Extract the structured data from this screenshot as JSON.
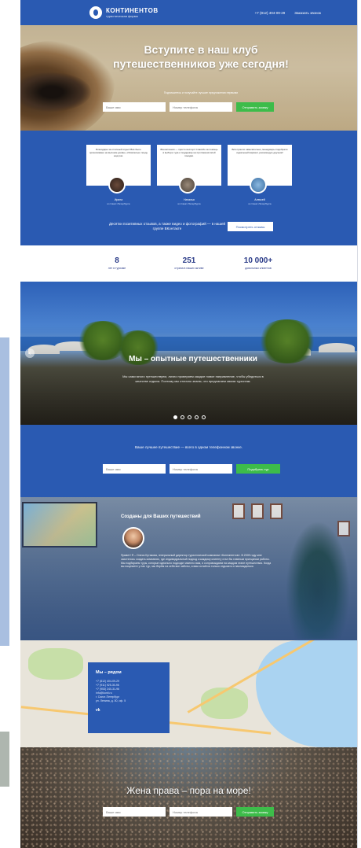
{
  "header": {
    "brand": "КОНТИНЕНТОВ",
    "brand_sub": "туристическая фирма",
    "phone": "+7 (812) 404-09-29",
    "callback": "Заказать звонок"
  },
  "hero": {
    "title": "Вступите в наш клуб путешественников уже сегодня!",
    "subtitle": "Подпишитесь и получайте лучшие предложения первыми",
    "name_placeholder": "Ваше имя",
    "phone_placeholder": "Номер телефона",
    "button": "Отправить заявку"
  },
  "testimonials": {
    "cards": [
      {
        "text": "Благодарю за отличный отдых! Всё было организовано на высшем уровне, обязательно поеду ещё раз.",
        "name": "Ирина",
        "role": "из Санкт-Петербурга"
      },
      {
        "text": "Впечатления — просто восторг! Спасибо за помощь в выборе тура и поддержку на протяжении всей поездки.",
        "name": "Наталья",
        "role": "из Санкт-Петербурга"
      },
      {
        "text": "Всё прошло замечательно, менеджеры подобрали идеальный вариант, рекомендую друзьям!",
        "name": "Алексей",
        "role": "из Санкт-Петербурга"
      }
    ],
    "footer_text": "Десятки позитивных отзывов, а также видео и фотографий — в нашей группе ВКонтакте",
    "footer_button": "Посмотреть отзывы"
  },
  "stats": [
    {
      "value": "8",
      "label": "лет в туризме"
    },
    {
      "value": "251",
      "label": "страна в наших активе"
    },
    {
      "value": "10 000+",
      "label": "довольных клиентов"
    }
  ],
  "slider": {
    "title": "Мы – опытные путешественники",
    "text": "Мы сами много путешествуем, лично проверяем каждое новое направление, чтобы убедиться в качестве отдыха. Поэтому мы отлично знаем, что предлагаем своим туристам.",
    "arrow": "‹",
    "active_slide": 1,
    "slide_count": 5
  },
  "phone_cta": {
    "text": "Ваше лучшее путешествие — всего в одном телефонном звонке.",
    "name_placeholder": "Ваше имя",
    "phone_placeholder": "Номер телефона",
    "button": "Подобрать тур"
  },
  "office": {
    "title": "Созданы для Ваших путешествий",
    "body": "Привет! Я – Олеся Кутякова, генеральный директор туристической компании «Континентов». В 2009 году мне захотелось создать компанию, где индивидуальный подход к каждому клиенту стал бы главным принципом работы. Мы подбираем туры, которые идеально подходят именно вам, и сопровождаем на каждом этапе путешествия. Когда вы покупаете у нас тур, мы берём на себя все заботы, а вам остаётся только отдыхать и наслаждаться."
  },
  "map": {
    "title": "Мы – рядом",
    "phones": [
      "+7 (812) 404-09-29",
      "+7 (911) 925-30-96",
      "+7 (953) 240-31-96"
    ],
    "email": "info@konti.ru",
    "city": "г. Санкт-Петербург",
    "address": "ул. Ленина, д. 00, оф. 5",
    "vk": "vk"
  },
  "final": {
    "title": "Жена права – пора на море!",
    "name_placeholder": "Ваше имя",
    "phone_placeholder": "Номер телефона",
    "button": "Отправить заявку"
  },
  "colors": {
    "brand_blue": "#2a5ab2",
    "cta_green": "#3dbc4a"
  }
}
